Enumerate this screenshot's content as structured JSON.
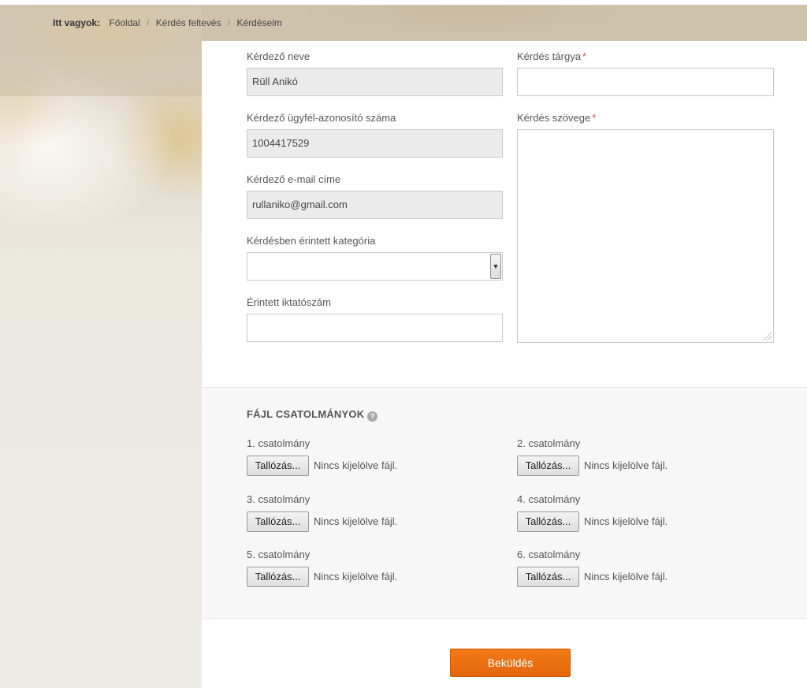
{
  "breadcrumb": {
    "lead": "Itt vagyok:",
    "items": [
      "Főoldal",
      "Kérdés feltevés",
      "Kérdéseim"
    ],
    "separator": "/"
  },
  "form": {
    "name_label": "Kérdező neve",
    "name_value": "Rüll Anikó",
    "client_id_label": "Kérdező ügyfél-azonosító száma",
    "client_id_value": "1004417529",
    "email_label": "Kérdező e-mail címe",
    "email_value": "rullaniko@gmail.com",
    "category_label": "Kérdésben érintett kategória",
    "category_value": "",
    "filing_label": "Érintett iktatószám",
    "filing_value": "",
    "subject_label": "Kérdés tárgya",
    "subject_value": "",
    "text_label": "Kérdés szövege",
    "text_value": "",
    "required_marker": "*"
  },
  "attachments": {
    "title": "FÁJL CSATOLMÁNYOK",
    "help_icon": "question-bubble-icon",
    "browse_label": "Tallózás...",
    "no_file_text": "Nincs kijelölve fájl.",
    "items": [
      {
        "label": "1. csatolmány"
      },
      {
        "label": "2. csatolmány"
      },
      {
        "label": "3. csatolmány"
      },
      {
        "label": "4. csatolmány"
      },
      {
        "label": "5. csatolmány"
      },
      {
        "label": "6. csatolmány"
      }
    ]
  },
  "submit": {
    "label": "Beküldés"
  },
  "colors": {
    "accent": "#ef7217",
    "required": "#d9534f",
    "readonly_bg": "#ebebeb"
  }
}
